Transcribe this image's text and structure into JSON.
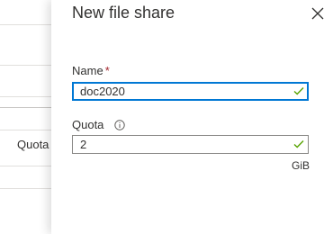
{
  "background": {
    "column_label": "Quota"
  },
  "panel": {
    "title": "New file share",
    "name_field": {
      "label": "Name",
      "required_mark": "*",
      "value": "doc2020"
    },
    "quota_field": {
      "label": "Quota",
      "value": "2",
      "unit": "GiB"
    },
    "icons": {
      "close": "close-icon",
      "info": "info-icon",
      "valid": "checkmark-icon"
    },
    "colors": {
      "focus_border": "#0078d4",
      "valid_check": "#57a300",
      "required": "#a4262c"
    }
  }
}
